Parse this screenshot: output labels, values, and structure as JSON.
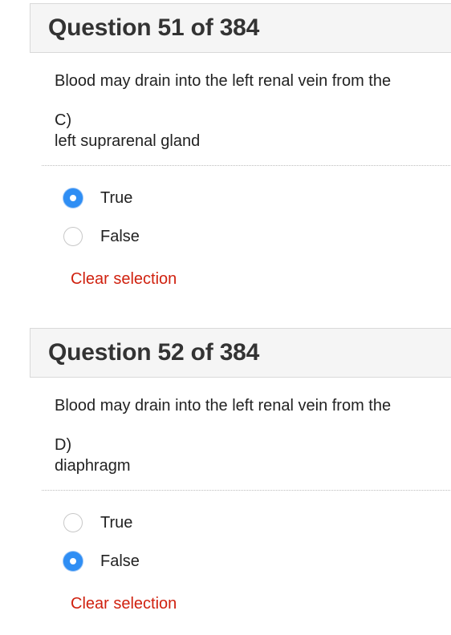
{
  "questions": [
    {
      "title": "Question 51 of 384",
      "stem": "Blood may drain into the left renal vein from the",
      "option_letter": "C)",
      "option_text": "left suprarenal gland",
      "answers": [
        {
          "label": "True",
          "checked": true
        },
        {
          "label": "False",
          "checked": false
        }
      ],
      "clear_label": "Clear selection"
    },
    {
      "title": "Question 52 of 384",
      "stem": "Blood may drain into the left renal vein from the",
      "option_letter": "D)",
      "option_text": "diaphragm",
      "answers": [
        {
          "label": "True",
          "checked": false
        },
        {
          "label": "False",
          "checked": true
        }
      ],
      "clear_label": "Clear selection"
    }
  ],
  "colors": {
    "accent": "#2f8ef4",
    "clear_link": "#d0210f",
    "header_bg": "#f5f5f5"
  }
}
